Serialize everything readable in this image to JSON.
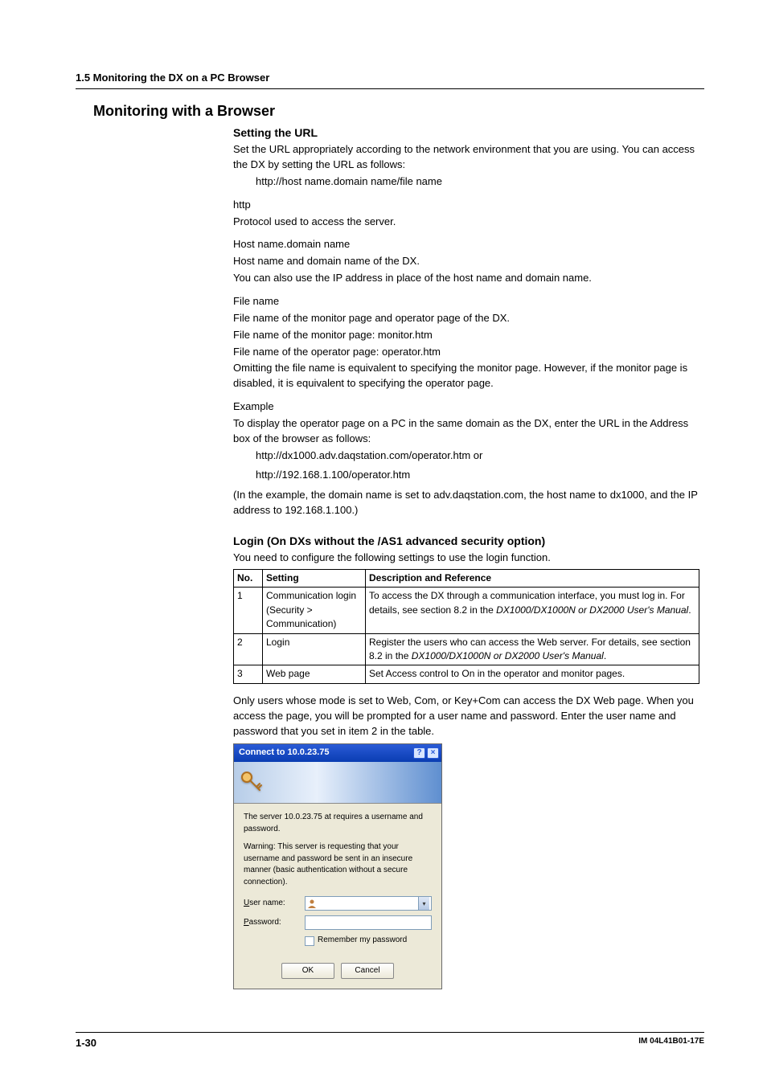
{
  "section_header": "1.5  Monitoring the DX on a PC Browser",
  "h1": "Monitoring with a Browser",
  "url": {
    "title": "Setting the URL",
    "p1": "Set the URL appropriately according to the network environment that you are using.  You can access the DX by setting the URL as follows:",
    "line": "http://host name.domain name/file name",
    "http_label": "http",
    "http_desc": "Protocol used to access the server.",
    "host_label": "Host name.domain name",
    "host_desc1": "Host name and domain name of the DX.",
    "host_desc2": "You can also use the IP address in place of the host name and domain name.",
    "file_label": "File name",
    "file_desc1": "File name of the monitor page and operator page of the DX.",
    "file_desc2": "File name of the monitor page: monitor.htm",
    "file_desc3": "File name of the operator page: operator.htm",
    "file_desc4": "Omitting the file name is equivalent to specifying the monitor page.  However, if the monitor page is disabled, it is equivalent to specifying the operator page.",
    "example_label": "Example",
    "example_desc": "To display the operator page on a PC in the same domain as the DX, enter the URL in the Address box of the browser as follows:",
    "example_line1": "http://dx1000.adv.daqstation.com/operator.htm or",
    "example_line2": "http://192.168.1.100/operator.htm",
    "example_note": "(In the example, the domain name is set to adv.daqstation.com, the host name to dx1000, and the IP address to 192.168.1.100.)"
  },
  "login": {
    "title": "Login (On DXs without the /AS1 advanced security option)",
    "intro": "You need to configure the following settings to use the login function.",
    "headers": {
      "no": "No.",
      "setting": "Setting",
      "desc": "Description and Reference"
    },
    "rows": [
      {
        "no": "1",
        "setting": "Communication login (Security > Communication)",
        "desc_pre": "To access the DX through a communication interface, you must log in. For details, see section 8.2 in the ",
        "desc_ital": "DX1000/DX1000N or DX2000 User's Manual",
        "desc_post": "."
      },
      {
        "no": "2",
        "setting": "Login",
        "desc_pre": "Register the users who can access the Web server. For details, see section 8.2 in the ",
        "desc_ital": "DX1000/DX1000N or DX2000 User's Manual",
        "desc_post": "."
      },
      {
        "no": "3",
        "setting": "Web page",
        "desc_pre": "Set Access control to On in the operator and monitor pages.",
        "desc_ital": "",
        "desc_post": ""
      }
    ],
    "after": "Only users whose mode is set to Web, Com, or Key+Com can access the DX Web page. When you access the page, you will be prompted for a user name and password. Enter the user name and password that you set in item 2 in the table."
  },
  "dialog": {
    "title": "Connect to 10.0.23.75",
    "msg1": "The server 10.0.23.75 at   requires a username and password.",
    "msg2": "Warning: This server is requesting that your username and password be sent in an insecure manner (basic authentication without a secure connection).",
    "user_un": "U",
    "user_rest": "ser name:",
    "pass_un": "P",
    "pass_rest": "assword:",
    "remember_un": "R",
    "remember_rest": "emember my password",
    "ok": "OK",
    "cancel": "Cancel"
  },
  "footer": {
    "page": "1-30",
    "im": "IM 04L41B01-17E"
  }
}
